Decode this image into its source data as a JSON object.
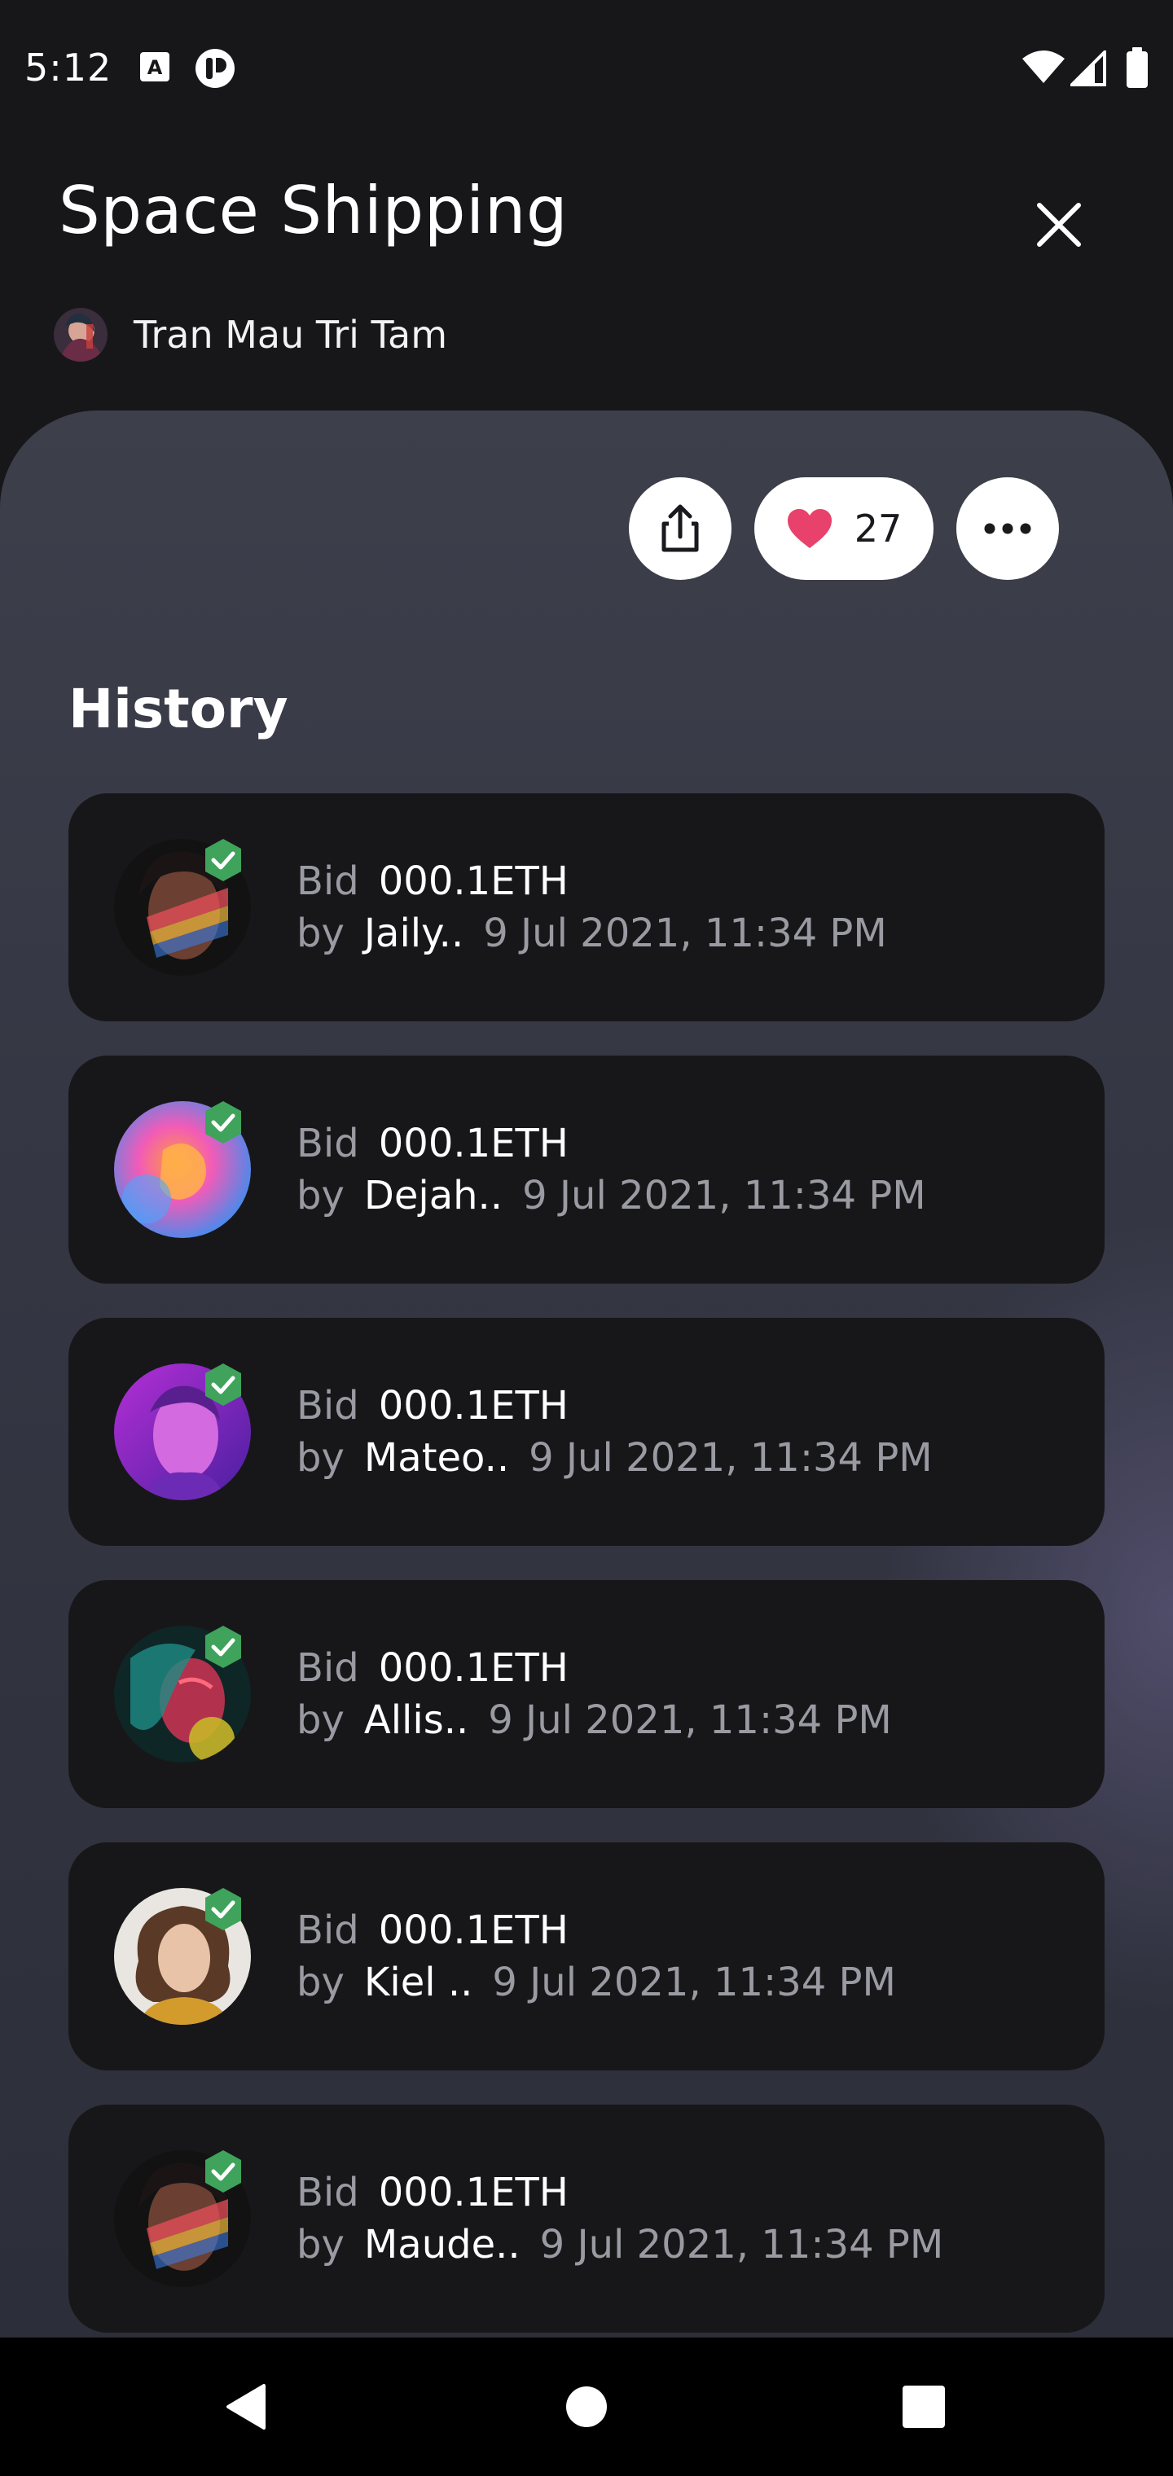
{
  "status_bar": {
    "time": "5:12",
    "icons": [
      "notification-a-icon",
      "app-icon",
      "wifi-icon",
      "signal-icon",
      "battery-icon"
    ]
  },
  "header": {
    "title": "Space Shipping",
    "author_name": "Tran Mau Tri Tam"
  },
  "actions": {
    "like_count": "27"
  },
  "history": {
    "title": "History",
    "items": [
      {
        "bid_label": "Bid",
        "amount": "000.1ETH",
        "by_label": "by",
        "user": "Jaily..",
        "date": "9 Jul 2021, 11:34 PM"
      },
      {
        "bid_label": "Bid",
        "amount": "000.1ETH",
        "by_label": "by",
        "user": "Dejah..",
        "date": "9 Jul 2021, 11:34 PM"
      },
      {
        "bid_label": "Bid",
        "amount": "000.1ETH",
        "by_label": "by",
        "user": "Mateo..",
        "date": "9 Jul 2021, 11:34 PM"
      },
      {
        "bid_label": "Bid",
        "amount": "000.1ETH",
        "by_label": "by",
        "user": "Allis..",
        "date": "9 Jul 2021, 11:34 PM"
      },
      {
        "bid_label": "Bid",
        "amount": "000.1ETH",
        "by_label": "by",
        "user": "Kiel ..",
        "date": "9 Jul 2021, 11:34 PM"
      },
      {
        "bid_label": "Bid",
        "amount": "000.1ETH",
        "by_label": "by",
        "user": "Maude..",
        "date": "9 Jul 2021, 11:34 PM"
      }
    ]
  },
  "colors": {
    "background": "#17171a",
    "panel": "#353744",
    "card": "#17171a",
    "heart": "#e8416b",
    "verified": "#3fa35b",
    "muted_text": "#9a9aa2"
  }
}
